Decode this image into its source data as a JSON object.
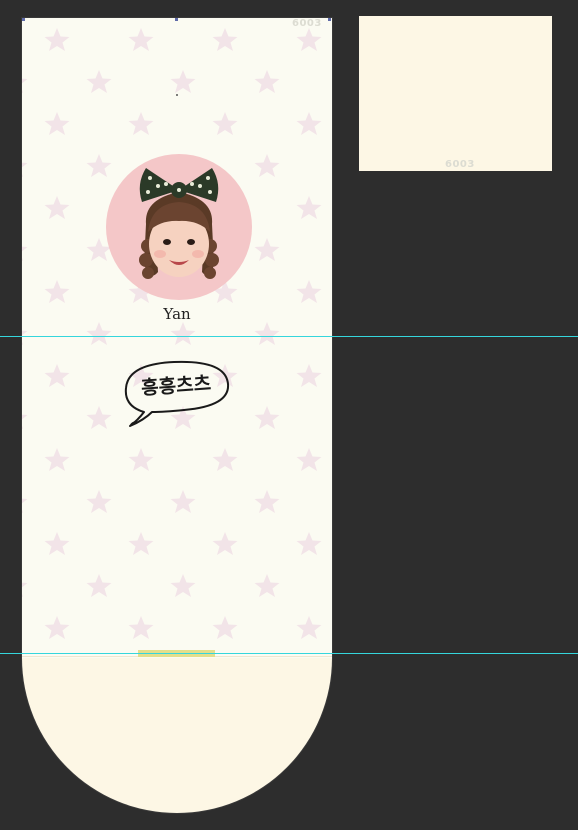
{
  "artboard": {
    "code_top": "6003",
    "name": "Yan",
    "bubble_text": "흥흥츠츠",
    "panel_color": "#fbfbf2",
    "star_color": "#f2e4e8",
    "sleeve_color": "#fdf7e5",
    "avatar_bg": "#f4c7c8",
    "tab_color": "#e3df8c"
  },
  "swatch": {
    "code": "6003",
    "color": "#fdf7e5"
  },
  "guides": {
    "color": "#35d6dc"
  },
  "icons": [
    "child-portrait-icon",
    "speech-bubble-icon",
    "star-pattern-icon"
  ]
}
